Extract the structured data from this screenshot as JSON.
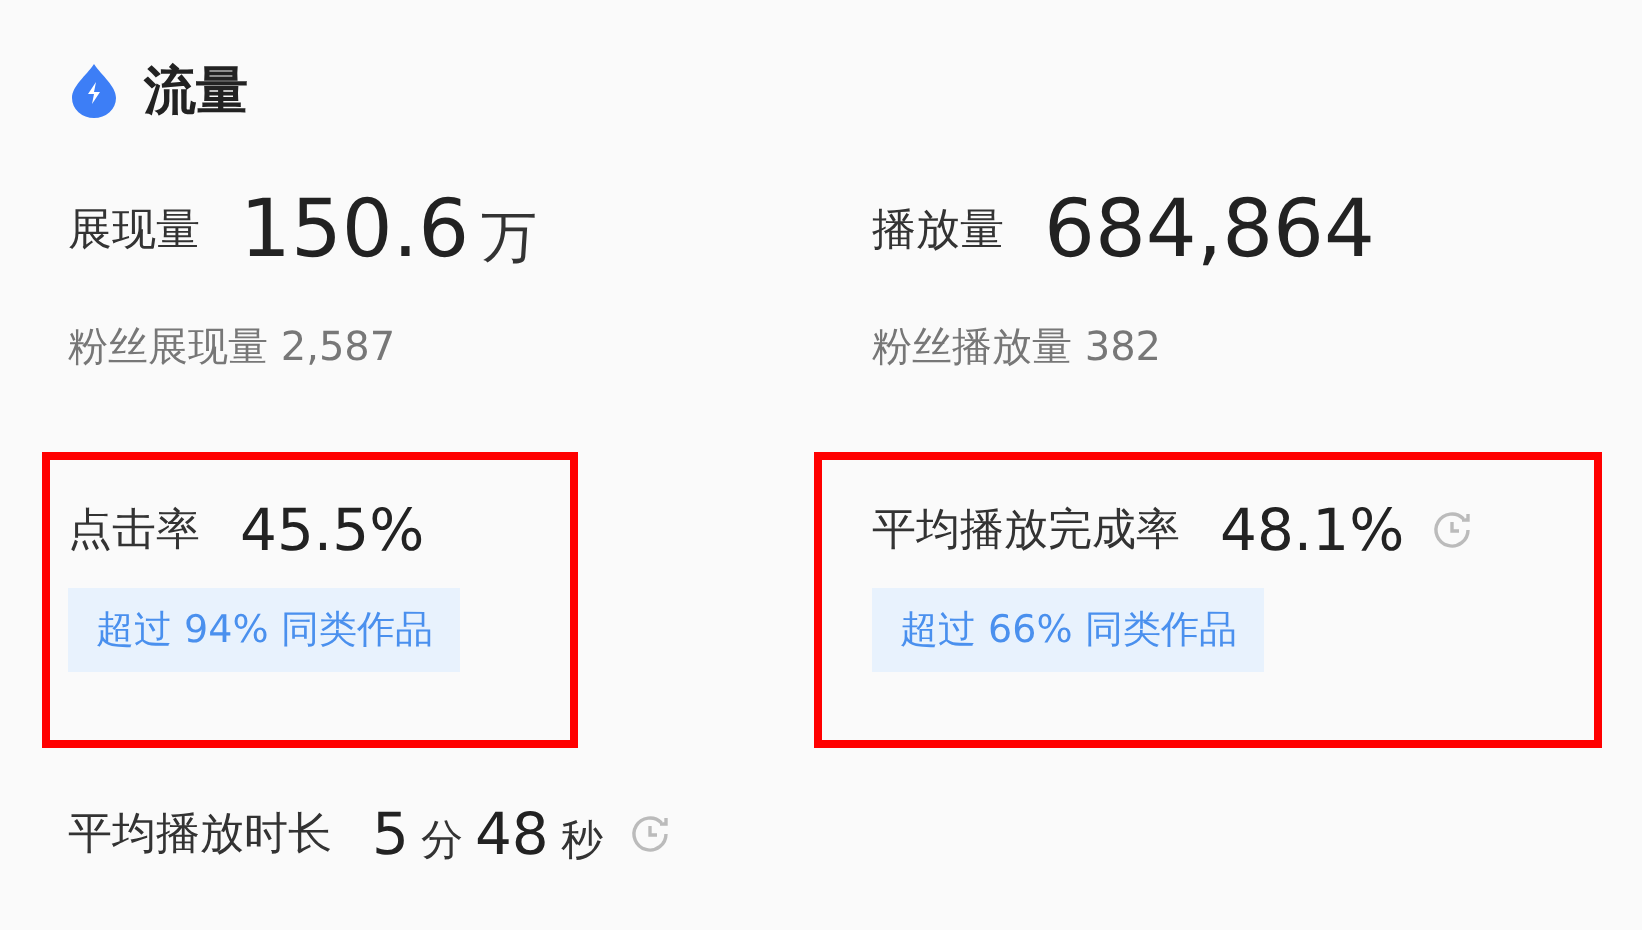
{
  "title": "流量",
  "metrics": [
    {
      "kind": "primary",
      "label": "展现量",
      "value": [
        {
          "kind": "number",
          "text": "150.6"
        },
        {
          "kind": "unit",
          "text": "万"
        }
      ],
      "sub": "粉丝展现量 2,587",
      "history": false,
      "highlighted": false
    },
    {
      "kind": "primary",
      "label": "播放量",
      "value": [
        {
          "kind": "number",
          "text": "684,864"
        }
      ],
      "sub": "粉丝播放量 382",
      "history": false,
      "highlighted": false
    },
    {
      "kind": "secondary",
      "label": "点击率",
      "value": [
        {
          "kind": "number",
          "text": "45.5%"
        }
      ],
      "badge": "超过 94% 同类作品",
      "history": false,
      "highlighted": true
    },
    {
      "kind": "secondary",
      "label": "平均播放完成率",
      "value": [
        {
          "kind": "number",
          "text": "48.1%"
        }
      ],
      "badge": "超过 66% 同类作品",
      "history": true,
      "highlighted": true
    },
    {
      "kind": "secondary",
      "label": "平均播放时长",
      "value": [
        {
          "kind": "number",
          "text": "5"
        },
        {
          "kind": "unit",
          "text": "分"
        },
        {
          "kind": "number",
          "text": "48"
        },
        {
          "kind": "unit",
          "text": "秒"
        }
      ],
      "history": true,
      "highlighted": false
    }
  ]
}
